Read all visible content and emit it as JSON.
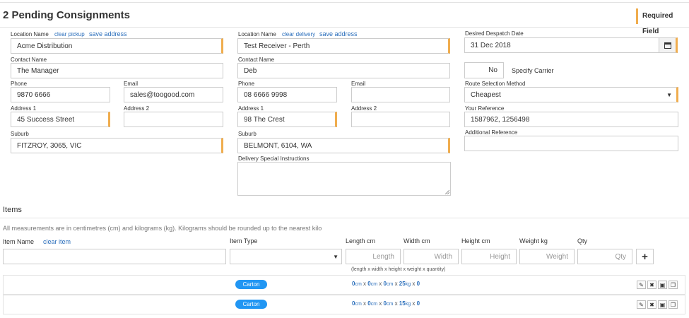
{
  "header": {
    "title": "2 Pending Consignments",
    "required_label": "Required Field"
  },
  "pickup": {
    "location_label": "Location Name",
    "clear_link": "clear pickup",
    "save_link": "save address",
    "location_value": "Acme Distribution",
    "contact_label": "Contact Name",
    "contact_value": "The Manager",
    "phone_label": "Phone",
    "phone_value": "9870 6666",
    "email_label": "Email",
    "email_value": "sales@toogood.com",
    "address1_label": "Address 1",
    "address1_value": "45 Success Street",
    "address2_label": "Address 2",
    "address2_value": "",
    "suburb_label": "Suburb",
    "suburb_value": "FITZROY, 3065, VIC"
  },
  "delivery": {
    "location_label": "Location Name",
    "clear_link": "clear delivery",
    "save_link": "save address",
    "location_value": "Test Receiver - Perth",
    "contact_label": "Contact Name",
    "contact_value": "Deb",
    "phone_label": "Phone",
    "phone_value": "08 6666 9998",
    "email_label": "Email",
    "email_value": "",
    "address1_label": "Address 1",
    "address1_value": "98 The Crest",
    "address2_label": "Address 2",
    "address2_value": "",
    "suburb_label": "Suburb",
    "suburb_value": "BELMONT, 6104, WA",
    "instructions_label": "Delivery Special Instructions",
    "instructions_value": ""
  },
  "options": {
    "despatch_label": "Desired Despatch Date",
    "despatch_value": "31 Dec 2018",
    "carrier_toggle_value": "No",
    "carrier_label": "Specify Carrier",
    "route_label": "Route Selection Method",
    "route_value": "Cheapest",
    "reference_label": "Your Reference",
    "reference_value": "1587962, 1256498",
    "additional_label": "Additional Reference",
    "additional_value": ""
  },
  "items": {
    "section_title": "Items",
    "note": "All measurements are in centimetres (cm) and kilograms (kg). Kilograms should be rounded up to the nearest kilo",
    "item_name_label": "Item Name",
    "clear_item_link": "clear item",
    "item_type_label": "Item Type",
    "length_label": "Length cm",
    "width_label": "Width cm",
    "height_label": "Height cm",
    "weight_label": "Weight kg",
    "qty_label": "Qty",
    "length_ph": "Length",
    "width_ph": "Width",
    "height_ph": "Height",
    "weight_ph": "Weight",
    "qty_ph": "Qty",
    "add_label": "+",
    "hint": "(length x  width x  height x  weight x  quantity)",
    "rows": [
      {
        "type": "Carton",
        "length": "0",
        "width": "0",
        "height": "0",
        "weight": "25",
        "qty": "0"
      },
      {
        "type": "Carton",
        "length": "0",
        "width": "0",
        "height": "0",
        "weight": "15",
        "qty": "0"
      }
    ],
    "unit_cm": "cm",
    "unit_kg": "kg",
    "times": "x"
  }
}
